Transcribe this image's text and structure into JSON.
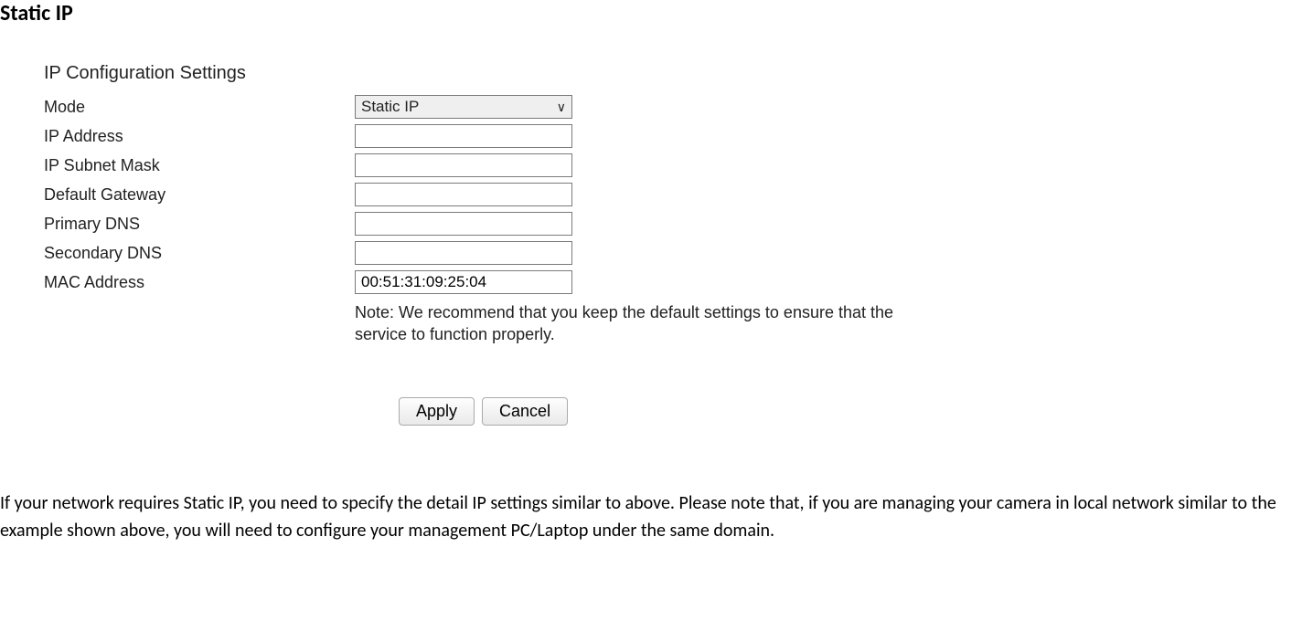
{
  "page": {
    "title": "Static IP"
  },
  "settings": {
    "heading": "IP Configuration Settings",
    "labels": {
      "mode": "Mode",
      "ip_address": "IP Address",
      "ip_subnet_mask": "IP Subnet Mask",
      "default_gateway": "Default Gateway",
      "primary_dns": "Primary DNS",
      "secondary_dns": "Secondary DNS",
      "mac_address": "MAC Address"
    },
    "values": {
      "mode_selected": "Static IP",
      "ip_address": "",
      "ip_subnet_mask": "",
      "default_gateway": "",
      "primary_dns": "",
      "secondary_dns": "",
      "mac_address": "00:51:31:09:25:04"
    },
    "note": "Note: We recommend that you keep the default settings to ensure that the service to function properly.",
    "buttons": {
      "apply": "Apply",
      "cancel": "Cancel"
    }
  },
  "body_text": "If your network requires Static IP, you need to specify the detail IP settings similar to above. Please note that, if you are managing your camera in local network similar to the example shown above, you will need to configure your management PC/Laptop under the same domain."
}
